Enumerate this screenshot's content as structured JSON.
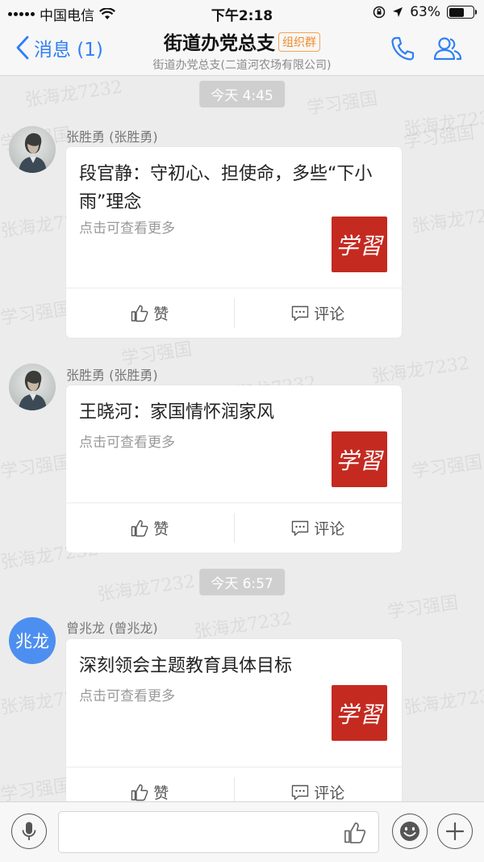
{
  "status_bar": {
    "carrier": "中国电信",
    "time": "下午2:18",
    "battery_percent": "63%",
    "battery_level": 0.63
  },
  "nav": {
    "back_label": "消息 (1)",
    "title": "街道办党总支",
    "badge": "组织群",
    "subtitle": "街道办党总支(二道河农场有限公司)"
  },
  "watermark": {
    "text_1": "张海龙7232",
    "text_2": "学习强国"
  },
  "messages": [
    {
      "time": "今天  4:45",
      "sender": "张胜勇 (张胜勇)",
      "title": "段官静：守初心、担使命，多些“下小雨”理念",
      "hint": "点击可查看更多",
      "thumb_text": "学習",
      "like_label": "赞",
      "comment_label": "评论"
    },
    {
      "sender": "张胜勇 (张胜勇)",
      "title": "王晓河：家国情怀润家风",
      "hint": "点击可查看更多",
      "thumb_text": "学習",
      "like_label": "赞",
      "comment_label": "评论"
    },
    {
      "time": "今天  6:57",
      "sender": "曾兆龙 (曾兆龙)",
      "avatar_text": "兆龙",
      "title": "深刻领会主题教育具体目标",
      "hint": "点击可查看更多",
      "thumb_text": "学習",
      "like_label": "赞",
      "comment_label": "评论"
    }
  ],
  "icons": {
    "back": "chevron-left-icon",
    "call": "phone-icon",
    "members": "group-members-icon",
    "like": "thumbs-up-icon",
    "comment": "comment-icon",
    "voice": "microphone-icon",
    "emoji": "emoji-icon",
    "add": "plus-icon"
  },
  "colors": {
    "accent": "#2f7ff5",
    "badge": "#f08c2a",
    "thumb_bg": "#c42a20",
    "avatar_blue": "#4d8ff0"
  }
}
